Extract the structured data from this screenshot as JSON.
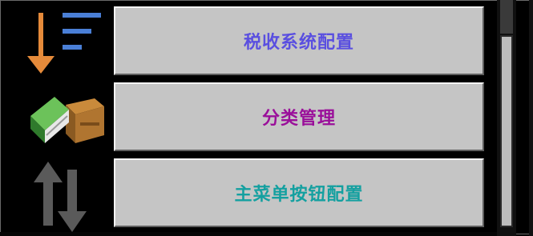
{
  "menu": {
    "items": [
      {
        "label": "税收系统配置",
        "color": "#5a4fe0",
        "icon": "sort-descending-icon"
      },
      {
        "label": "分类管理",
        "color": "#9a0f9a",
        "icon": "books-and-box-icon"
      },
      {
        "label": "主菜单按钮配置",
        "color": "#14a0a0",
        "icon": "up-down-arrows-icon"
      }
    ]
  }
}
